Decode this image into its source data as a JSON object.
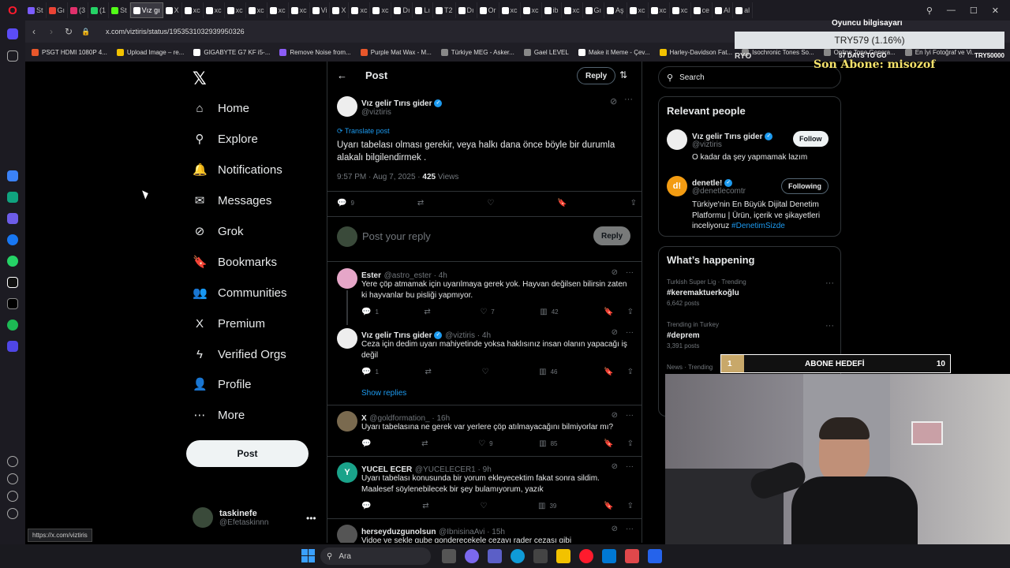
{
  "browser": {
    "tabs": [
      {
        "label": "St",
        "color": "#7b5cff"
      },
      {
        "label": "Gı",
        "color": "#ea4335"
      },
      {
        "label": "(3",
        "color": "#e1306c"
      },
      {
        "label": "(1",
        "color": "#25d366"
      },
      {
        "label": "St",
        "color": "#53fc18"
      },
      {
        "label": "Vız gı",
        "color": "#ffffff",
        "active": true
      },
      {
        "label": "X",
        "color": "#ffffff"
      },
      {
        "label": "xc",
        "color": "#ffffff"
      },
      {
        "label": "xc",
        "color": "#ffffff"
      },
      {
        "label": "xc",
        "color": "#ffffff"
      },
      {
        "label": "xc",
        "color": "#ffffff"
      },
      {
        "label": "xc",
        "color": "#ffffff"
      },
      {
        "label": "xc",
        "color": "#ffffff"
      },
      {
        "label": "Vi",
        "color": "#ffffff"
      },
      {
        "label": "X",
        "color": "#ffffff"
      },
      {
        "label": "xc",
        "color": "#ffffff"
      },
      {
        "label": "xc",
        "color": "#ffffff"
      },
      {
        "label": "Dı",
        "color": "#ffffff"
      },
      {
        "label": "Lı",
        "color": "#ffffff"
      },
      {
        "label": "T2",
        "color": "#ffffff"
      },
      {
        "label": "Dı",
        "color": "#ffffff"
      },
      {
        "label": "Or",
        "color": "#ffffff"
      },
      {
        "label": "xc",
        "color": "#ffffff"
      },
      {
        "label": "xc",
        "color": "#ffffff"
      },
      {
        "label": "ib",
        "color": "#ffffff"
      },
      {
        "label": "xc",
        "color": "#ffffff"
      },
      {
        "label": "Gı",
        "color": "#ffffff"
      },
      {
        "label": "Aş",
        "color": "#ffffff"
      },
      {
        "label": "xc",
        "color": "#ffffff"
      },
      {
        "label": "xc",
        "color": "#ffffff"
      },
      {
        "label": "xc",
        "color": "#ffffff"
      },
      {
        "label": "ce",
        "color": "#ffffff"
      },
      {
        "label": "Al",
        "color": "#ffffff"
      },
      {
        "label": "al",
        "color": "#ffffff"
      }
    ],
    "url": "x.com/viztiris/status/1953531032939950326",
    "bookmarks": [
      {
        "label": "PSGT HDMI 1080P 4...",
        "color": "#e8572b"
      },
      {
        "label": "Upload Image – re...",
        "color": "#f2c200"
      },
      {
        "label": "GIGABYTE G7 KF i5-...",
        "color": "#ffffff"
      },
      {
        "label": "Remove Noise from...",
        "color": "#8b5cf6"
      },
      {
        "label": "Purple Mat Wax - M...",
        "color": "#e8572b"
      },
      {
        "label": "Türkiye MEG - Asker...",
        "color": "#888888"
      },
      {
        "label": "Gael LEVEL",
        "color": "#888888"
      },
      {
        "label": "Make it Meme - Çev...",
        "color": "#ffffff"
      },
      {
        "label": "Harley-Davidson Fat...",
        "color": "#f2c200"
      },
      {
        "label": "Isochronic Tones So...",
        "color": "#888888"
      },
      {
        "label": "Online Tone Genera...",
        "color": "#888888"
      },
      {
        "label": "En İyi Fotoğraf ve Vi...",
        "color": "#888888"
      }
    ],
    "status_url": "https://x.com/viztiris"
  },
  "nav": {
    "items": [
      {
        "label": "Home",
        "icon": "⌂"
      },
      {
        "label": "Explore",
        "icon": "⚲"
      },
      {
        "label": "Notifications",
        "icon": "🔔"
      },
      {
        "label": "Messages",
        "icon": "✉"
      },
      {
        "label": "Grok",
        "icon": "⊘"
      },
      {
        "label": "Bookmarks",
        "icon": "🔖"
      },
      {
        "label": "Communities",
        "icon": "👥"
      },
      {
        "label": "Premium",
        "icon": "X"
      },
      {
        "label": "Verified Orgs",
        "icon": "ϟ"
      },
      {
        "label": "Profile",
        "icon": "👤"
      },
      {
        "label": "More",
        "icon": "⋯"
      }
    ],
    "post_label": "Post",
    "account": {
      "name": "taskinefe",
      "handle": "@Efetaskinnn"
    }
  },
  "main": {
    "title": "Post",
    "reply_pill": "Reply",
    "post": {
      "author": "Vız gelir Tırıs gider",
      "handle": "@viztiris",
      "translate": "Translate post",
      "text": "Uyarı tabelası olması gerekir, veya halkı dana önce böyle bir durumla alakalı bilgilendirmek .",
      "time": "9:57 PM · Aug 7, 2025 · ",
      "views_count": "425",
      "views_label": " Views",
      "replies": "9"
    },
    "compose": {
      "placeholder": "Post your reply",
      "button": "Reply"
    },
    "replies": [
      {
        "name": "Ester",
        "handle": "@astro_ester · 4h",
        "text": "Yere çöp atmamak için uyarılmaya gerek yok. Hayvan değilsen bilirsin zaten ki hayvanlar bu pisliği yapmıyor.",
        "reply": "1",
        "retweet": "",
        "like": "7",
        "views": "42",
        "avatar_color": "#e6a6c8"
      },
      {
        "name": "Vız gelir Tırıs gider",
        "handle": "@viztiris · 4h",
        "text": "Ceza için dedim uyarı mahiyetinde yoksa haklısınız insan olanın yapacağı iş değil",
        "reply": "1",
        "retweet": "",
        "like": "",
        "views": "46",
        "avatar_color": "#eeeeee"
      },
      {
        "name": "X",
        "handle": "@goldformation_ · 16h",
        "text": "Uyarı tabelasına ne gerek var yerlere çöp atılmayacağını bilmiyorlar mı?",
        "reply": "",
        "retweet": "",
        "like": "9",
        "views": "85",
        "avatar_color": "#7a6a4f"
      },
      {
        "name": "YUCEL ECER",
        "handle": "@YUCELECER1 · 9h",
        "text": "Uyarı tabelası konusunda bir yorum ekleyecektim fakat sonra sildim. Maalesef söylenebilecek bir şey bulamıyorum, yazık",
        "reply": "",
        "retweet": "",
        "like": "",
        "views": "39",
        "avatar_color": "#1aa38a",
        "initial": "Y"
      },
      {
        "name": "herseyduzgunolsun",
        "handle": "@IbnisinaAvi · 15h",
        "text": "Vidoe ve sekle gube gonderecekele cezayı rader cezası gibi",
        "avatar_color": "#555555"
      }
    ],
    "show_replies": "Show replies"
  },
  "right": {
    "search_placeholder": "Search",
    "relevant": {
      "title": "Relevant people",
      "people": [
        {
          "name": "Vız gelir Tırıs gider",
          "handle": "@viztiris",
          "bio": "O kadar da şey yapmamak lazım",
          "button": "Follow"
        },
        {
          "name": "denetle!",
          "handle": "@denetlecomtr",
          "bio": "Türkiye'nin En Büyük Dijital Denetim Platformu | Ürün, içerik ve şikayetleri inceliyoruz ",
          "bio_tag": "#DenetimSizde",
          "button": "Following",
          "initial": "d!"
        }
      ]
    },
    "happening": {
      "title": "What’s happening",
      "trends": [
        {
          "category": "Turkish Super Lig · Trending",
          "tag": "#keremaktuerkoğlu",
          "count": "6,642 posts"
        },
        {
          "category": "Trending in Turkey",
          "tag": "#deprem",
          "count": "3,391 posts"
        },
        {
          "category": "News · Trending",
          "tag": "",
          "count": ""
        }
      ]
    }
  },
  "overlay": {
    "gamer": "Oyuncu bilgisayarı",
    "currency": "TRY579 (1.16%)",
    "ryo": "RYO",
    "days": "57 DAYS TO GO",
    "goal_amount": "TRY50000",
    "sub_text": "Son Abone: misozof",
    "goal_bar": {
      "current": "1",
      "label": "ABONE HEDEFİ",
      "target": "10",
      "progress": 0.1
    }
  },
  "taskbar": {
    "search_label": "Ara"
  }
}
